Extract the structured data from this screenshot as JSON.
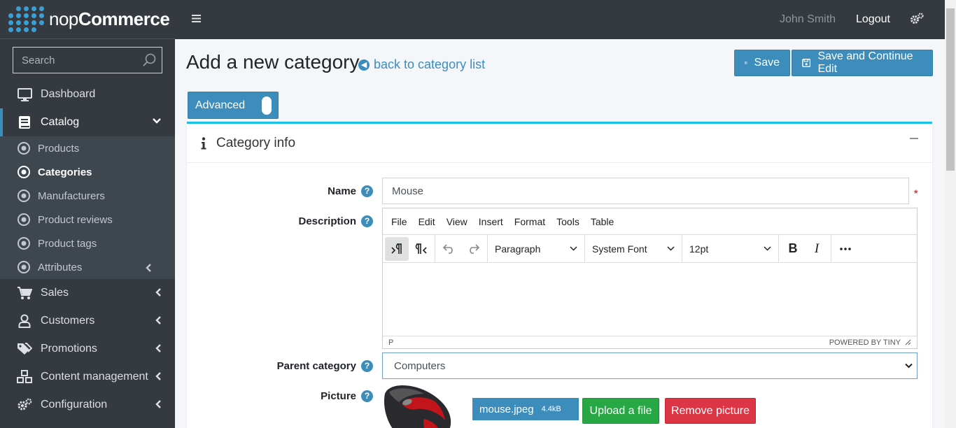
{
  "brand": {
    "name_bold": "nop",
    "name_rest": "Commerce"
  },
  "sidebar": {
    "search_placeholder": "Search",
    "items": [
      {
        "label": "Dashboard",
        "icon": "monitor-icon"
      },
      {
        "label": "Catalog",
        "icon": "book-icon",
        "expanded": true
      },
      {
        "label": "Sales",
        "icon": "cart-icon"
      },
      {
        "label": "Customers",
        "icon": "user-icon"
      },
      {
        "label": "Promotions",
        "icon": "tags-icon"
      },
      {
        "label": "Content management",
        "icon": "cubes-icon"
      },
      {
        "label": "Configuration",
        "icon": "gears-icon"
      }
    ],
    "catalog_sub": [
      {
        "label": "Products"
      },
      {
        "label": "Categories",
        "current": true
      },
      {
        "label": "Manufacturers"
      },
      {
        "label": "Product reviews"
      },
      {
        "label": "Product tags"
      },
      {
        "label": "Attributes"
      }
    ]
  },
  "topbar": {
    "user": "John Smith",
    "logout": "Logout"
  },
  "page": {
    "title": "Add a new category",
    "back_link": "back to category list",
    "save": "Save",
    "save_continue": "Save and Continue Edit",
    "advanced_toggle": "Advanced"
  },
  "card": {
    "title": "Category info",
    "fields": {
      "name_label": "Name",
      "name_value": "Mouse",
      "required_mark": "*",
      "description_label": "Description",
      "parent_label": "Parent category",
      "parent_value": "Computers",
      "picture_label": "Picture"
    },
    "editor": {
      "menu": [
        "File",
        "Edit",
        "View",
        "Insert",
        "Format",
        "Tools",
        "Table"
      ],
      "block_format": "Paragraph",
      "font_family": "System Font",
      "font_size": "12pt",
      "path": "P",
      "powered_by": "POWERED BY TINY"
    },
    "picture": {
      "file_name": "mouse.jpeg",
      "file_size": "4.4kB",
      "upload_label": "Upload a file",
      "remove_label": "Remove picture"
    }
  },
  "colors": {
    "sidebar_bg": "#343a40",
    "primary": "#3c8dbc",
    "card_accent": "#17c1e8",
    "success": "#28a745",
    "danger": "#dc3545"
  }
}
